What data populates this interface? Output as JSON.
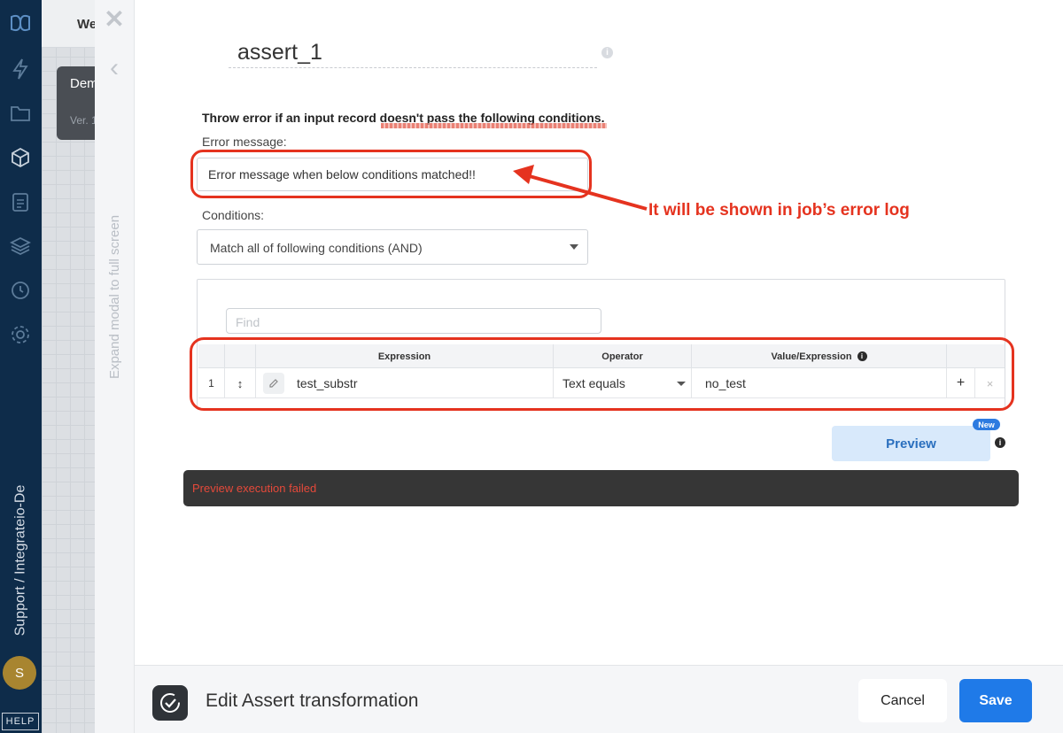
{
  "sidebar": {
    "icons": [
      "logo-icon",
      "bolt-icon",
      "folder-icon",
      "package-icon",
      "clipboard-icon",
      "layers-icon",
      "history-icon",
      "settings-icon"
    ],
    "workspace_label": "Support / Integrateio-De",
    "avatar_initial": "S",
    "help_label": "HELP"
  },
  "background": {
    "tab_label": "We",
    "card_title": "Dem",
    "card_sub": "Ver. 1"
  },
  "modal_strip": {
    "close_symbol": "✕",
    "back_symbol": "‹",
    "expand_label": "Expand modal to full screen"
  },
  "component": {
    "name": "assert_1",
    "info_symbol": "i"
  },
  "form": {
    "description": "Throw error if an input record doesn't pass the following conditions.",
    "error_message_label": "Error message:",
    "error_message_value": "Error message when below conditions matched!!",
    "conditions_label": "Conditions:",
    "conditions_mode": "Match all of following conditions (AND)"
  },
  "annotation": {
    "text": "It will be shown in job’s error log",
    "color": "#e5331f"
  },
  "grid": {
    "find_placeholder": "Find",
    "columns": [
      "Expression",
      "Operator",
      "Value/Expression"
    ],
    "rows": [
      {
        "index": "1",
        "drag": "↕",
        "expression": "test_substr",
        "operator": "Text equals",
        "value": "no_test",
        "add": "+",
        "remove": "×"
      }
    ]
  },
  "preview": {
    "label": "Preview",
    "badge": "New",
    "info_symbol": "i"
  },
  "status": {
    "message": "Preview execution failed"
  },
  "footer": {
    "title": "Edit Assert transformation",
    "cancel_label": "Cancel",
    "save_label": "Save",
    "accent": "#1f7ae8"
  }
}
